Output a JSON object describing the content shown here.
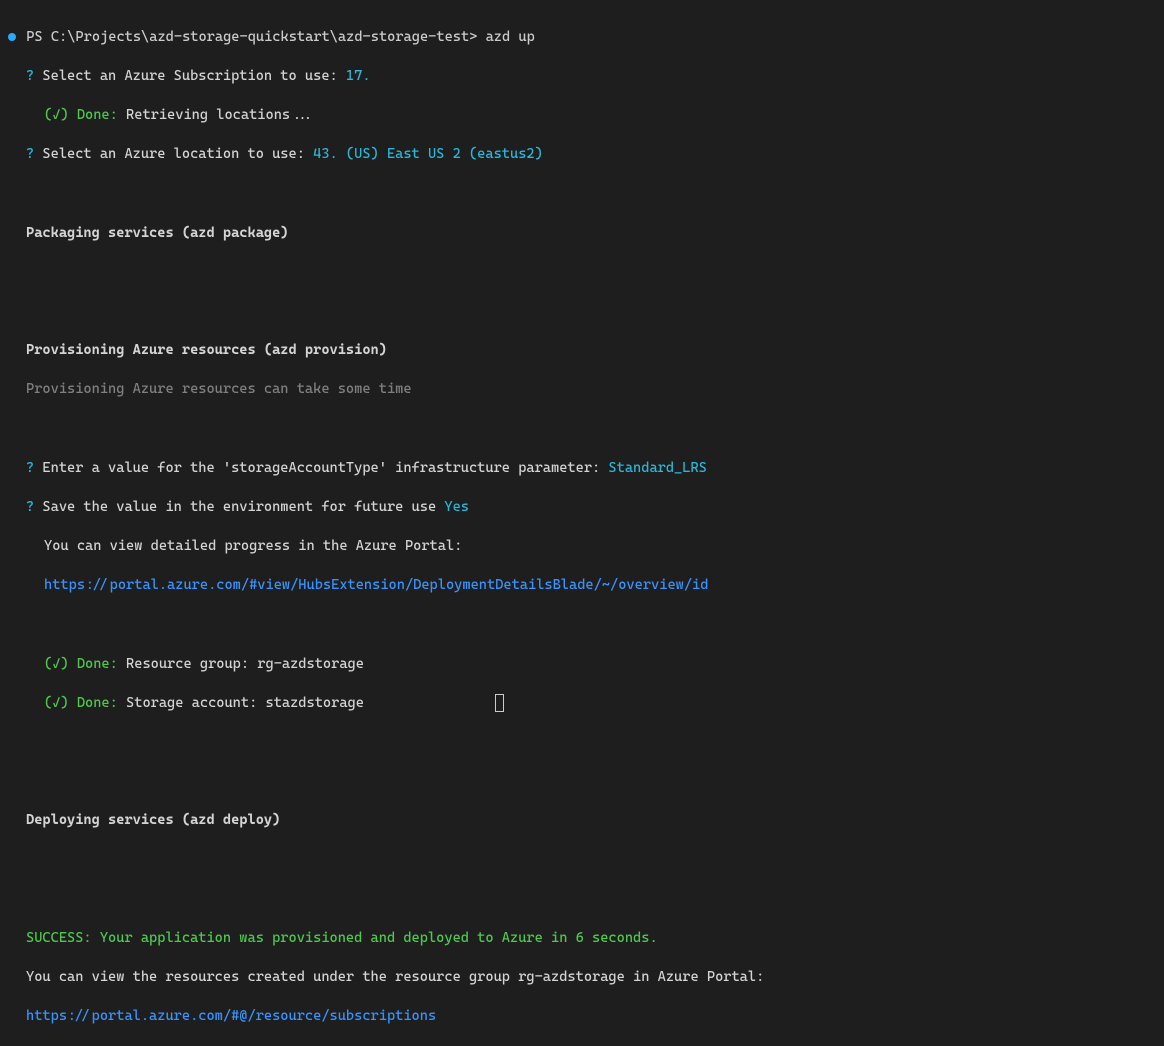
{
  "prompt": {
    "shell": "PS",
    "path": "C:\\Projects\\azd-storage-quickstart\\azd-storage-test>",
    "command": "azd up"
  },
  "lines": {
    "q1_prefix": "?",
    "q1_text": "Select an Azure Subscription to use:",
    "q1_answer": "17.",
    "done1_check": "(✓)",
    "done1_label": "Done:",
    "done1_text": "Retrieving locations...",
    "q2_prefix": "?",
    "q2_text": "Select an Azure location to use:",
    "q2_answer": "43. (US) East US 2 (eastus2)",
    "section_packaging": "Packaging services (azd package)",
    "section_provisioning": "Provisioning Azure resources (azd provision)",
    "provisioning_note": "Provisioning Azure resources can take some time",
    "q3_prefix": "?",
    "q3_text": "Enter a value for the 'storageAccountType' infrastructure parameter:",
    "q3_answer": "Standard_LRS",
    "q4_prefix": "?",
    "q4_text": "Save the value in the environment for future use",
    "q4_answer": "Yes",
    "progress_text": "You can view detailed progress in the Azure Portal:",
    "progress_url": "https://portal.azure.com/#view/HubsExtension/DeploymentDetailsBlade/~/overview/id",
    "done2_check": "(✓)",
    "done2_label": "Done:",
    "done2_text": "Resource group: rg-azdstorage",
    "done3_check": "(✓)",
    "done3_label": "Done:",
    "done3_text": "Storage account: stazdstorage",
    "section_deploying": "Deploying services (azd deploy)",
    "success": "SUCCESS: Your application was provisioned and deployed to Azure in 6 seconds.",
    "view_resources": "You can view the resources created under the resource group rg-azdstorage in Azure Portal:",
    "final_url": "https://portal.azure.com/#@/resource/subscriptions"
  }
}
